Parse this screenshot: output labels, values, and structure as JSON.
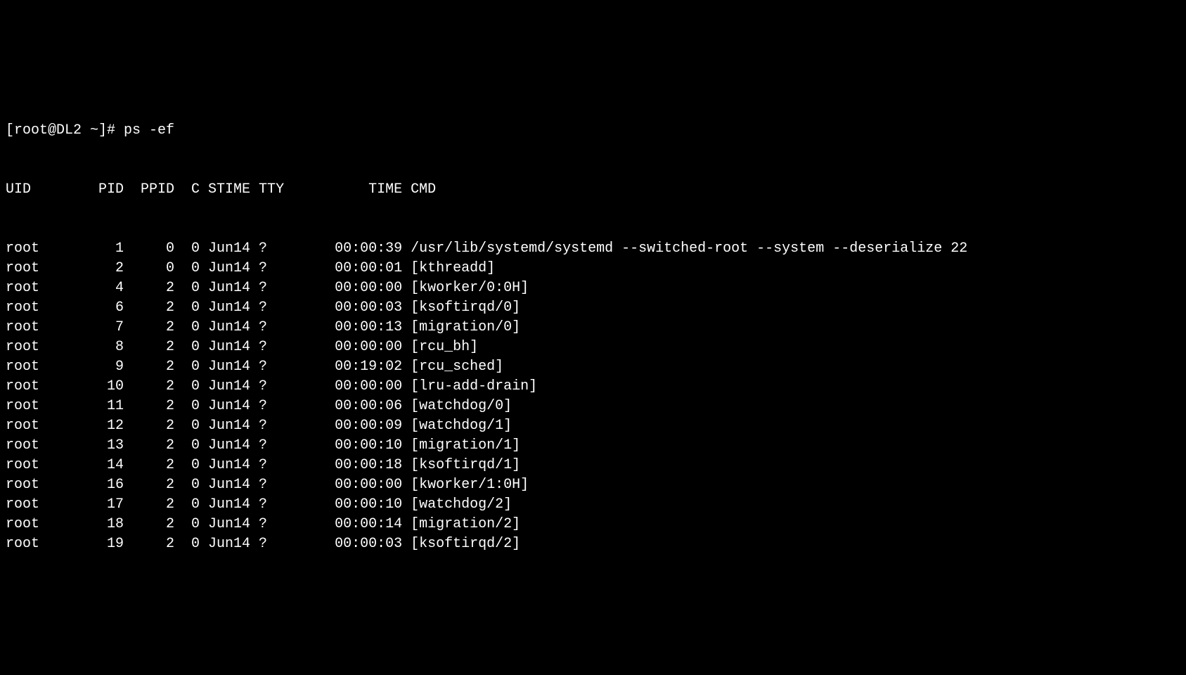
{
  "prompt": "[root@DL2 ~]# ps -ef",
  "header": {
    "uid": "UID",
    "pid": "PID",
    "ppid": "PPID",
    "c": "C",
    "stime": "STIME",
    "tty": "TTY",
    "time": "TIME",
    "cmd": "CMD"
  },
  "processes": [
    {
      "uid": "root",
      "pid": "1",
      "ppid": "0",
      "c": "0",
      "stime": "Jun14",
      "tty": "?",
      "time": "00:00:39",
      "cmd": "/usr/lib/systemd/systemd --switched-root --system --deserialize 22"
    },
    {
      "uid": "root",
      "pid": "2",
      "ppid": "0",
      "c": "0",
      "stime": "Jun14",
      "tty": "?",
      "time": "00:00:01",
      "cmd": "[kthreadd]"
    },
    {
      "uid": "root",
      "pid": "4",
      "ppid": "2",
      "c": "0",
      "stime": "Jun14",
      "tty": "?",
      "time": "00:00:00",
      "cmd": "[kworker/0:0H]"
    },
    {
      "uid": "root",
      "pid": "6",
      "ppid": "2",
      "c": "0",
      "stime": "Jun14",
      "tty": "?",
      "time": "00:00:03",
      "cmd": "[ksoftirqd/0]"
    },
    {
      "uid": "root",
      "pid": "7",
      "ppid": "2",
      "c": "0",
      "stime": "Jun14",
      "tty": "?",
      "time": "00:00:13",
      "cmd": "[migration/0]"
    },
    {
      "uid": "root",
      "pid": "8",
      "ppid": "2",
      "c": "0",
      "stime": "Jun14",
      "tty": "?",
      "time": "00:00:00",
      "cmd": "[rcu_bh]"
    },
    {
      "uid": "root",
      "pid": "9",
      "ppid": "2",
      "c": "0",
      "stime": "Jun14",
      "tty": "?",
      "time": "00:19:02",
      "cmd": "[rcu_sched]"
    },
    {
      "uid": "root",
      "pid": "10",
      "ppid": "2",
      "c": "0",
      "stime": "Jun14",
      "tty": "?",
      "time": "00:00:00",
      "cmd": "[lru-add-drain]"
    },
    {
      "uid": "root",
      "pid": "11",
      "ppid": "2",
      "c": "0",
      "stime": "Jun14",
      "tty": "?",
      "time": "00:00:06",
      "cmd": "[watchdog/0]"
    },
    {
      "uid": "root",
      "pid": "12",
      "ppid": "2",
      "c": "0",
      "stime": "Jun14",
      "tty": "?",
      "time": "00:00:09",
      "cmd": "[watchdog/1]"
    },
    {
      "uid": "root",
      "pid": "13",
      "ppid": "2",
      "c": "0",
      "stime": "Jun14",
      "tty": "?",
      "time": "00:00:10",
      "cmd": "[migration/1]"
    },
    {
      "uid": "root",
      "pid": "14",
      "ppid": "2",
      "c": "0",
      "stime": "Jun14",
      "tty": "?",
      "time": "00:00:18",
      "cmd": "[ksoftirqd/1]"
    },
    {
      "uid": "root",
      "pid": "16",
      "ppid": "2",
      "c": "0",
      "stime": "Jun14",
      "tty": "?",
      "time": "00:00:00",
      "cmd": "[kworker/1:0H]"
    },
    {
      "uid": "root",
      "pid": "17",
      "ppid": "2",
      "c": "0",
      "stime": "Jun14",
      "tty": "?",
      "time": "00:00:10",
      "cmd": "[watchdog/2]"
    },
    {
      "uid": "root",
      "pid": "18",
      "ppid": "2",
      "c": "0",
      "stime": "Jun14",
      "tty": "?",
      "time": "00:00:14",
      "cmd": "[migration/2]"
    },
    {
      "uid": "root",
      "pid": "19",
      "ppid": "2",
      "c": "0",
      "stime": "Jun14",
      "tty": "?",
      "time": "00:00:03",
      "cmd": "[ksoftirqd/2]"
    }
  ]
}
